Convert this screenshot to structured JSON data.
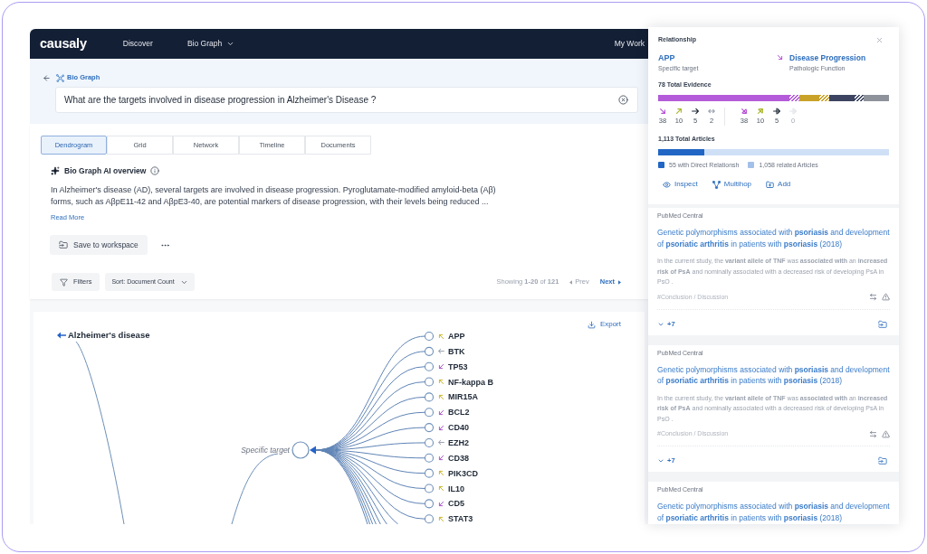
{
  "header": {
    "logo": "causaly",
    "nav": [
      {
        "label": "Discover",
        "has_menu": false
      },
      {
        "label": "Bio Graph",
        "has_menu": true
      }
    ],
    "account": "My Work"
  },
  "search": {
    "breadcrumb": "Bio Graph",
    "value": "What are the targets involved in disease progression in Alzheimer's Disease ?"
  },
  "view_tabs": [
    {
      "label": "Dendrogram",
      "selected": true
    },
    {
      "label": "Grid",
      "selected": false
    },
    {
      "label": "Network",
      "selected": false
    },
    {
      "label": "Timeline",
      "selected": false
    },
    {
      "label": "Documents",
      "selected": false
    }
  ],
  "overview": {
    "title": "Bio Graph AI overview",
    "text": "In Alzheimer's disease (AD), several targets are involved in disease progression. Pyroglutamate-modified amyloid-beta (Aβ) forms, such as AβpE11-42 and AβpE3-40, are potential markers of disease progression, with their levels being reduced ...",
    "read_more": "Read More",
    "save_button": "Save to workspace"
  },
  "results_toolbar": {
    "filters": "Filters",
    "sort": "Sort: Document Count",
    "showing": "Showing **1-20** of **121**",
    "prev": {
      "label": "Prev",
      "disabled": true
    },
    "next": {
      "label": "Next",
      "disabled": false
    }
  },
  "dendrogram": {
    "export": "Export",
    "root": "Alzheimer's disease",
    "branch": "Specific target",
    "targets": [
      {
        "label": "APP",
        "kind": "increase"
      },
      {
        "label": "BTK",
        "kind": "neutral"
      },
      {
        "label": "TP53",
        "kind": "decrease"
      },
      {
        "label": "NF-kappa B",
        "kind": "increase"
      },
      {
        "label": "MIR15A",
        "kind": "increase"
      },
      {
        "label": "BCL2",
        "kind": "decrease"
      },
      {
        "label": "CD40",
        "kind": "decrease"
      },
      {
        "label": "EZH2",
        "kind": "neutral"
      },
      {
        "label": "CD38",
        "kind": "decrease"
      },
      {
        "label": "PIK3CD",
        "kind": "increase"
      },
      {
        "label": "IL10",
        "kind": "increase"
      },
      {
        "label": "CD5",
        "kind": "decrease"
      },
      {
        "label": "STAT3",
        "kind": "increase"
      }
    ]
  },
  "relationship_panel": {
    "title": "Relationship",
    "source": {
      "name": "APP",
      "type": "Specific target"
    },
    "target": {
      "name": "Disease Progression",
      "type": "Pathologic Function",
      "kind": "decrease"
    },
    "evidence_total": "78 Total Evidence",
    "evidence_counts": [
      {
        "kind": "decrease",
        "count": "38",
        "disabled": false
      },
      {
        "kind": "increase",
        "count": "10",
        "disabled": false
      },
      {
        "kind": "neutral",
        "count": "5",
        "disabled": false
      },
      {
        "kind": "bidirectional",
        "count": "2",
        "disabled": false
      }
    ],
    "negated_counts": [
      {
        "kind": "decrease",
        "count": "38",
        "disabled": false
      },
      {
        "kind": "increase",
        "count": "10",
        "disabled": false
      },
      {
        "kind": "neutral",
        "count": "5",
        "disabled": false
      },
      {
        "kind": "neutral",
        "count": "0",
        "disabled": true
      }
    ],
    "articles_total": "1,113 Total Articles",
    "articles_bar": {
      "level": 0.2
    },
    "legend": [
      {
        "label": "55 with Direct Relationsh",
        "color": "#2166c4"
      },
      {
        "label": "1,058 related Articles",
        "color": "#a3c0e8"
      }
    ],
    "actions": [
      {
        "kind": "inspect",
        "label": "Inspect"
      },
      {
        "kind": "multihop",
        "label": "Multihop"
      },
      {
        "kind": "add",
        "label": "Add"
      }
    ]
  },
  "articles": [
    {
      "source": "PubMed Central",
      "title": "Genetic polymorphisms associated with **psoriasis** and development of **psoriatic arthritis** in patients with **psoriasis** (2018)",
      "snippet": "In the current study, the **variant allele of TNF** was **associated with** an **increased risk of PsA** and nominally associated with a decreased risk of developing PsA in PsO .",
      "section": "#Conclusion / Discussion",
      "more": "+7"
    },
    {
      "source": "PubMed Central",
      "title": "Genetic polymorphisms associated with **psoriasis** and development of **psoriatic arthritis** in patients with **psoriasis** (2018)",
      "snippet": "In the current study, the **variant allele of TNF** was **associated with** an **increased risk of PsA** and nominally associated with a decreased risk of developing PsA in PsO .",
      "section": "#Conclusion / Discussion",
      "more": "+7"
    },
    {
      "source": "PubMed Central",
      "title": "Genetic polymorphisms associated with **psoriasis** and development of **psoriatic arthritis** in patients with **psoriasis** (2018)"
    }
  ]
}
